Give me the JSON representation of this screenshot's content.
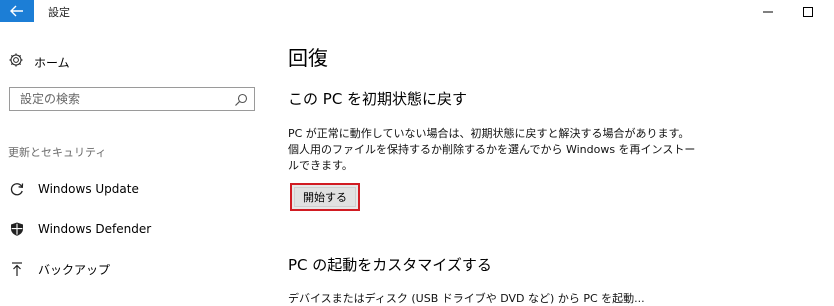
{
  "window": {
    "title": "設定",
    "accent": "#1c7ed6"
  },
  "sidebar": {
    "home_label": "ホーム",
    "search_placeholder": "設定の検索",
    "section_label": "更新とセキュリティ",
    "items": [
      {
        "label": "Windows Update",
        "icon": "sync-icon"
      },
      {
        "label": "Windows Defender",
        "icon": "shield-icon"
      },
      {
        "label": "バックアップ",
        "icon": "backup-arrow-icon"
      }
    ]
  },
  "main": {
    "title": "回復",
    "reset_title": "この PC を初期状態に戻す",
    "reset_desc": "PC が正常に動作していない場合は、初期状態に戻すと解決する場合があります。個人用のファイルを保持するか削除するかを選んでから Windows を再インストールできます。",
    "start_button": "開始する",
    "startup_title": "PC の起動をカスタマイズする",
    "startup_desc_partial": "デバイスまたはディスク (USB ドライブや DVD など) から PC を起動..."
  },
  "colors": {
    "highlight_border": "#d11b22"
  }
}
